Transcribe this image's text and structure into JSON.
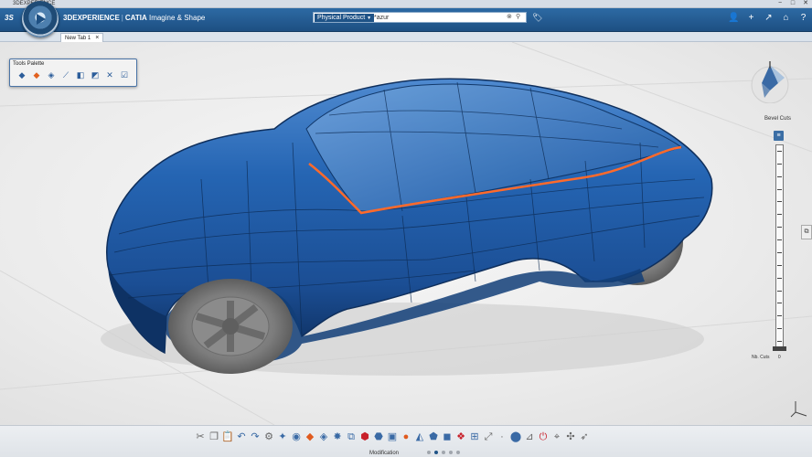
{
  "window": {
    "title": "3DEXPERIENCE",
    "controls": [
      "−",
      "□",
      "✕"
    ]
  },
  "header": {
    "brand_ds": "3S",
    "brand_name": "3DEXPERIENCE",
    "brand_separator": "|",
    "brand_app": "CATIA",
    "brand_sub": "Imagine & Shape",
    "search": {
      "scope": "Physical Product",
      "value": "*azur"
    },
    "actions": [
      {
        "name": "profile-button",
        "glyph": "👤"
      },
      {
        "name": "add-button",
        "glyph": "+"
      },
      {
        "name": "share-button",
        "glyph": "↗"
      },
      {
        "name": "home-button",
        "glyph": "⌂"
      },
      {
        "name": "help-button",
        "glyph": "?"
      }
    ]
  },
  "tabs": [
    {
      "label": "New Tab 1"
    }
  ],
  "tools_palette": {
    "title": "Tools Palette",
    "items": [
      {
        "name": "select-tool",
        "glyph": "◆",
        "accent": false
      },
      {
        "name": "move-tool",
        "glyph": "◆",
        "accent": true
      },
      {
        "name": "subdivision-tool",
        "glyph": "◈",
        "accent": false
      },
      {
        "name": "curve-tool",
        "glyph": "⟋",
        "accent": false
      },
      {
        "name": "edge-tool",
        "glyph": "◧",
        "accent": false
      },
      {
        "name": "face-tool",
        "glyph": "◩",
        "accent": false
      },
      {
        "name": "symmetry-tool",
        "glyph": "✕",
        "accent": false
      },
      {
        "name": "validate-tool",
        "glyph": "☑",
        "accent": false
      }
    ]
  },
  "bevel": {
    "label": "Bevel Cuts",
    "nb_cuts_label": "Nb. Cuts",
    "nb_cuts_value": "0",
    "ticks": 16
  },
  "actionbar": {
    "section": "Modification",
    "pages": 5,
    "active_page": 1,
    "icons": [
      {
        "name": "cut-icon",
        "glyph": "✂",
        "tone": "gray"
      },
      {
        "name": "copy-icon",
        "glyph": "❐",
        "tone": "gray"
      },
      {
        "name": "paste-icon",
        "glyph": "📋",
        "tone": "gray"
      },
      {
        "name": "undo-icon",
        "glyph": "↶",
        "tone": "blue"
      },
      {
        "name": "redo-icon",
        "glyph": "↷",
        "tone": "blue"
      },
      {
        "name": "settings-icon",
        "glyph": "⚙",
        "tone": "gray"
      },
      {
        "name": "transform-icon",
        "glyph": "✦",
        "tone": "blue"
      },
      {
        "name": "subdivide-icon",
        "glyph": "◉",
        "tone": "blue"
      },
      {
        "name": "extrude-icon",
        "glyph": "◆",
        "tone": "orange"
      },
      {
        "name": "bevel-icon",
        "glyph": "◈",
        "tone": "blue"
      },
      {
        "name": "crease-icon",
        "glyph": "✸",
        "tone": "blue"
      },
      {
        "name": "symmetry-icon",
        "glyph": "⧉",
        "tone": "blue"
      },
      {
        "name": "attract-icon",
        "glyph": "⬢",
        "tone": "red"
      },
      {
        "name": "weight-icon",
        "glyph": "⬣",
        "tone": "blue"
      },
      {
        "name": "cage-icon",
        "glyph": "▣",
        "tone": "blue"
      },
      {
        "name": "sphere-icon",
        "glyph": "●",
        "tone": "orange"
      },
      {
        "name": "fill-icon",
        "glyph": "◭",
        "tone": "blue"
      },
      {
        "name": "merge-icon",
        "glyph": "⬟",
        "tone": "blue"
      },
      {
        "name": "cube-icon",
        "glyph": "◼",
        "tone": "blue"
      },
      {
        "name": "pattern-icon",
        "glyph": "❖",
        "tone": "red"
      },
      {
        "name": "grid-icon",
        "glyph": "⊞",
        "tone": "blue"
      },
      {
        "name": "scale-icon",
        "glyph": "⤢",
        "tone": "gray"
      },
      {
        "name": "sep-icon",
        "glyph": "·",
        "tone": "gray"
      },
      {
        "name": "render-icon",
        "glyph": "⬤",
        "tone": "blue"
      },
      {
        "name": "measure-icon",
        "glyph": "⊿",
        "tone": "gray"
      },
      {
        "name": "power-icon",
        "glyph": "⏻",
        "tone": "red"
      },
      {
        "name": "xyz-icon",
        "glyph": "⌖",
        "tone": "gray"
      },
      {
        "name": "compass-icon",
        "glyph": "✣",
        "tone": "gray"
      },
      {
        "name": "pointer-icon",
        "glyph": "➶",
        "tone": "gray"
      }
    ]
  },
  "colors": {
    "body_paint": "#1f57a3",
    "accent_edge": "#ff6a2b",
    "brand": "#1d4f82"
  }
}
